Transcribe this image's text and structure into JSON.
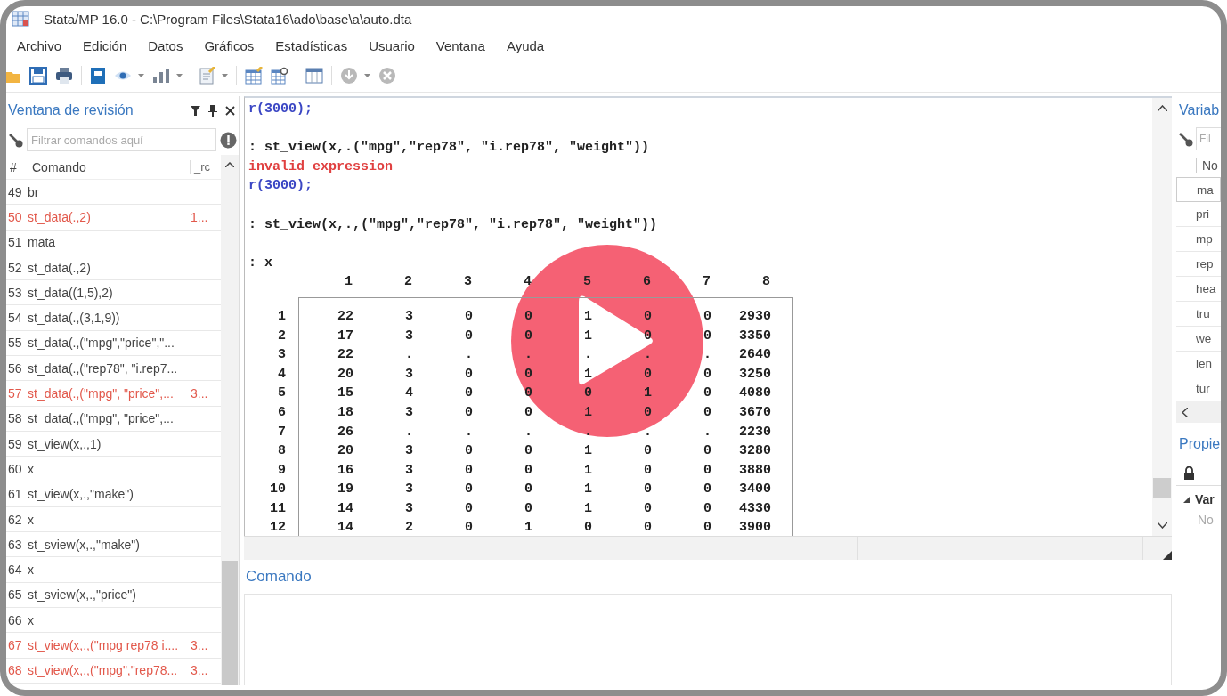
{
  "window": {
    "title": "Stata/MP 16.0 - C:\\Program Files\\Stata16\\ado\\base\\a\\auto.dta"
  },
  "menu": [
    "Archivo",
    "Edición",
    "Datos",
    "Gráficos",
    "Estadísticas",
    "Usuario",
    "Ventana",
    "Ayuda"
  ],
  "review": {
    "title": "Ventana de revisión",
    "filter": {
      "placeholder": "Filtrar comandos aquí"
    },
    "columns": [
      "#",
      "Comando",
      "_rc"
    ],
    "rows": [
      {
        "num": "49",
        "command": "br",
        "error": false
      },
      {
        "num": "50",
        "command": "st_data(.,2)",
        "rc": "1...",
        "error": true
      },
      {
        "num": "51",
        "command": "mata",
        "error": false
      },
      {
        "num": "52",
        "command": "st_data(.,2)",
        "error": false
      },
      {
        "num": "53",
        "command": "st_data((1,5),2)",
        "error": false
      },
      {
        "num": "54",
        "command": "st_data(.,(3,1,9))",
        "error": false
      },
      {
        "num": "55",
        "command": "st_data(.,(\"mpg\",\"price\",\"...",
        "error": false
      },
      {
        "num": "56",
        "command": "st_data(.,(\"rep78\", \"i.rep7...",
        "error": false
      },
      {
        "num": "57",
        "command": "st_data(.,(\"mpg\", \"price\",...",
        "rc": "3...",
        "error": true
      },
      {
        "num": "58",
        "command": "st_data(.,(\"mpg\", \"price\",...",
        "error": false
      },
      {
        "num": "59",
        "command": "st_view(x,.,1)",
        "error": false
      },
      {
        "num": "60",
        "command": "x",
        "error": false
      },
      {
        "num": "61",
        "command": "st_view(x,.,\"make\")",
        "error": false
      },
      {
        "num": "62",
        "command": "x",
        "error": false
      },
      {
        "num": "63",
        "command": "st_sview(x,.,\"make\")",
        "error": false
      },
      {
        "num": "64",
        "command": "x",
        "error": false
      },
      {
        "num": "65",
        "command": "st_sview(x,.,\"price\")",
        "error": false
      },
      {
        "num": "66",
        "command": "x",
        "error": false
      },
      {
        "num": "67",
        "command": "st_view(x,.,(\"mpg rep78 i....",
        "rc": "3...",
        "error": true
      },
      {
        "num": "68",
        "command": "st_view(x,.,(\"mpg\",\"rep78...",
        "rc": "3...",
        "error": true
      }
    ]
  },
  "results": {
    "lines": [
      {
        "kind": "return",
        "text": "r(3000);"
      },
      {
        "kind": "command",
        "text": ": st_view(x,.(\"mpg\",\"rep78\", \"i.rep78\", \"weight\"))"
      },
      {
        "kind": "error",
        "text": "invalid expression"
      },
      {
        "kind": "return",
        "text": "r(3000);"
      },
      {
        "kind": "command",
        "text": ": st_view(x,.,(\"mpg\",\"rep78\", \"i.rep78\", \"weight\"))"
      },
      {
        "kind": "command",
        "text": ": x"
      }
    ],
    "matrix": {
      "columns": [
        "1",
        "2",
        "3",
        "4",
        "5",
        "6",
        "7",
        "8"
      ],
      "rows": [
        {
          "label": "1",
          "values": [
            "22",
            "3",
            "0",
            "0",
            "1",
            "0",
            "0",
            "2930"
          ]
        },
        {
          "label": "2",
          "values": [
            "17",
            "3",
            "0",
            "0",
            "1",
            "0",
            "0",
            "3350"
          ]
        },
        {
          "label": "3",
          "values": [
            "22",
            ".",
            ".",
            ".",
            ".",
            ".",
            ".",
            "2640"
          ]
        },
        {
          "label": "4",
          "values": [
            "20",
            "3",
            "0",
            "0",
            "1",
            "0",
            "0",
            "3250"
          ]
        },
        {
          "label": "5",
          "values": [
            "15",
            "4",
            "0",
            "0",
            "0",
            "1",
            "0",
            "4080"
          ]
        },
        {
          "label": "6",
          "values": [
            "18",
            "3",
            "0",
            "0",
            "1",
            "0",
            "0",
            "3670"
          ]
        },
        {
          "label": "7",
          "values": [
            "26",
            ".",
            ".",
            ".",
            ".",
            ".",
            ".",
            "2230"
          ]
        },
        {
          "label": "8",
          "values": [
            "20",
            "3",
            "0",
            "0",
            "1",
            "0",
            "0",
            "3280"
          ]
        },
        {
          "label": "9",
          "values": [
            "16",
            "3",
            "0",
            "0",
            "1",
            "0",
            "0",
            "3880"
          ]
        },
        {
          "label": "10",
          "values": [
            "19",
            "3",
            "0",
            "0",
            "1",
            "0",
            "0",
            "3400"
          ]
        },
        {
          "label": "11",
          "values": [
            "14",
            "3",
            "0",
            "0",
            "1",
            "0",
            "0",
            "4330"
          ]
        },
        {
          "label": "12",
          "values": [
            "14",
            "2",
            "0",
            "1",
            "0",
            "0",
            "0",
            "3900"
          ]
        }
      ]
    }
  },
  "command_panel": {
    "title": "Comando"
  },
  "variables": {
    "title": "Variab",
    "filter": {
      "placeholder": "Fil"
    },
    "column": "No",
    "rows": [
      {
        "name": "ma",
        "selected": true
      },
      {
        "name": "pri",
        "selected": false
      },
      {
        "name": "mp",
        "selected": false
      },
      {
        "name": "rep",
        "selected": false
      },
      {
        "name": "hea",
        "selected": false
      },
      {
        "name": "tru",
        "selected": false
      },
      {
        "name": "we",
        "selected": false
      },
      {
        "name": "len",
        "selected": false
      },
      {
        "name": "tur",
        "selected": false
      }
    ]
  },
  "properties": {
    "title": "Propie",
    "section": "Var",
    "field": "No"
  }
}
